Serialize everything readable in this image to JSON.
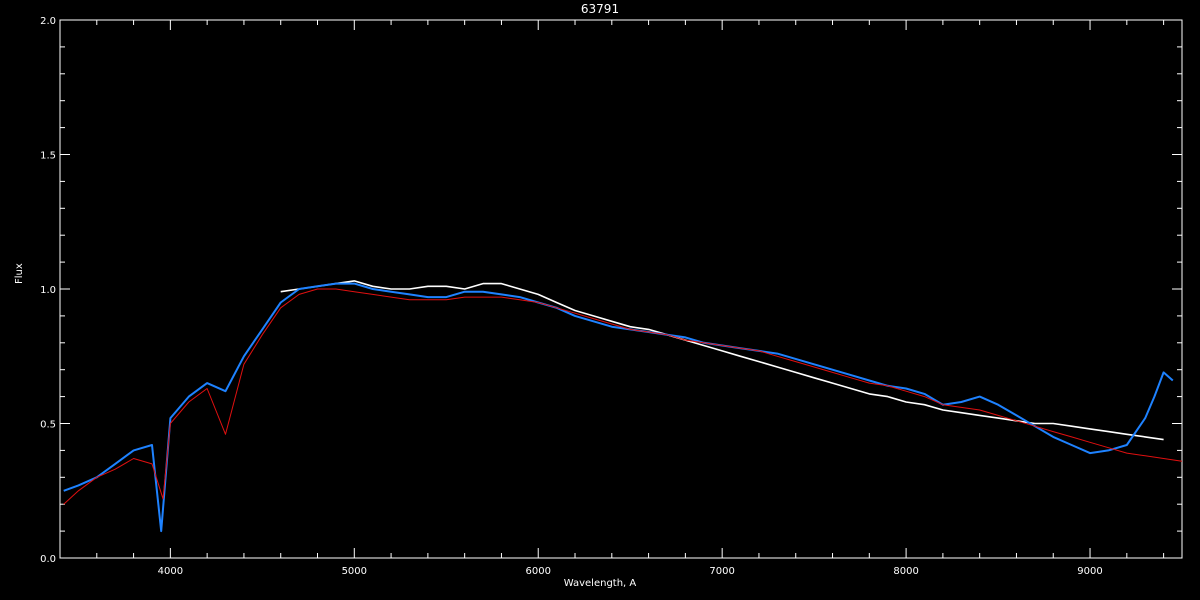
{
  "chart_data": {
    "type": "line",
    "title": "63791",
    "xlabel": "Wavelength, A",
    "ylabel": "Flux",
    "xlim": [
      3400,
      9500
    ],
    "ylim": [
      0.0,
      2.0
    ],
    "x_ticks": [
      4000,
      5000,
      6000,
      7000,
      8000,
      9000
    ],
    "y_ticks": [
      0.0,
      0.5,
      1.0,
      1.5,
      2.0
    ],
    "x_tick_labels": [
      "4000",
      "5000",
      "6000",
      "7000",
      "8000",
      "9000"
    ],
    "y_tick_labels": [
      "0.0",
      "0.5",
      "1.0",
      "1.5",
      "2.0"
    ],
    "grid": false,
    "background": "#000000",
    "axis_color": "#ffffff",
    "series": [
      {
        "color": "#ffffff",
        "x": [
          4600,
          4700,
          4800,
          4900,
          5000,
          5100,
          5200,
          5300,
          5400,
          5500,
          5600,
          5700,
          5800,
          5900,
          6000,
          6100,
          6200,
          6300,
          6400,
          6500,
          6600,
          6700,
          6800,
          6900,
          7000,
          7100,
          7200,
          7300,
          7400,
          7500,
          7600,
          7700,
          7800,
          7900,
          8000,
          8100,
          8200,
          8300,
          8400,
          8500,
          8600,
          8700,
          8800,
          8900,
          9000,
          9100,
          9200,
          9300,
          9400
        ],
        "y": [
          0.99,
          1.0,
          1.01,
          1.02,
          1.03,
          1.01,
          1.0,
          1.0,
          1.01,
          1.01,
          1.0,
          1.02,
          1.02,
          1.0,
          0.98,
          0.95,
          0.92,
          0.9,
          0.88,
          0.86,
          0.85,
          0.83,
          0.81,
          0.79,
          0.77,
          0.75,
          0.73,
          0.71,
          0.69,
          0.67,
          0.65,
          0.63,
          0.61,
          0.6,
          0.58,
          0.57,
          0.55,
          0.54,
          0.53,
          0.52,
          0.51,
          0.5,
          0.5,
          0.49,
          0.48,
          0.47,
          0.46,
          0.45,
          0.44
        ]
      },
      {
        "color": "#1e82ff",
        "x": [
          3420,
          3500,
          3600,
          3700,
          3800,
          3900,
          3950,
          4000,
          4100,
          4200,
          4300,
          4400,
          4500,
          4600,
          4700,
          4800,
          4900,
          5000,
          5100,
          5200,
          5300,
          5400,
          5500,
          5600,
          5700,
          5800,
          5900,
          6000,
          6100,
          6200,
          6300,
          6400,
          6500,
          6600,
          6700,
          6800,
          6900,
          7000,
          7100,
          7200,
          7300,
          7400,
          7500,
          7600,
          7700,
          7800,
          7900,
          8000,
          8100,
          8200,
          8300,
          8400,
          8500,
          8600,
          8700,
          8800,
          8900,
          9000,
          9100,
          9200,
          9300,
          9350,
          9400,
          9450
        ],
        "y": [
          0.25,
          0.27,
          0.3,
          0.35,
          0.4,
          0.42,
          0.1,
          0.52,
          0.6,
          0.65,
          0.62,
          0.75,
          0.85,
          0.95,
          1.0,
          1.01,
          1.02,
          1.02,
          1.0,
          0.99,
          0.98,
          0.97,
          0.97,
          0.99,
          0.99,
          0.98,
          0.97,
          0.95,
          0.93,
          0.9,
          0.88,
          0.86,
          0.85,
          0.84,
          0.83,
          0.82,
          0.8,
          0.79,
          0.78,
          0.77,
          0.76,
          0.74,
          0.72,
          0.7,
          0.68,
          0.66,
          0.64,
          0.63,
          0.61,
          0.57,
          0.58,
          0.6,
          0.57,
          0.53,
          0.49,
          0.45,
          0.42,
          0.39,
          0.4,
          0.42,
          0.52,
          0.6,
          0.69,
          0.66
        ]
      },
      {
        "color": "#e01010",
        "x": [
          3420,
          3500,
          3600,
          3700,
          3800,
          3900,
          3960,
          4000,
          4100,
          4200,
          4300,
          4400,
          4500,
          4600,
          4700,
          4800,
          4900,
          5000,
          5100,
          5200,
          5300,
          5400,
          5500,
          5600,
          5700,
          5800,
          5900,
          6000,
          6100,
          6200,
          6300,
          6400,
          6500,
          6600,
          6700,
          6800,
          6900,
          7000,
          7100,
          7200,
          7300,
          7400,
          7500,
          7600,
          7700,
          7800,
          7900,
          8000,
          8100,
          8200,
          8300,
          8400,
          8500,
          8600,
          8700,
          8800,
          8900,
          9000,
          9100,
          9200,
          9300,
          9400,
          9500
        ],
        "y": [
          0.2,
          0.25,
          0.3,
          0.33,
          0.37,
          0.35,
          0.22,
          0.5,
          0.58,
          0.63,
          0.46,
          0.72,
          0.83,
          0.93,
          0.98,
          1.0,
          1.0,
          0.99,
          0.98,
          0.97,
          0.96,
          0.96,
          0.96,
          0.97,
          0.97,
          0.97,
          0.96,
          0.95,
          0.93,
          0.91,
          0.89,
          0.87,
          0.85,
          0.84,
          0.83,
          0.81,
          0.8,
          0.79,
          0.78,
          0.77,
          0.75,
          0.73,
          0.71,
          0.69,
          0.67,
          0.65,
          0.64,
          0.62,
          0.6,
          0.57,
          0.56,
          0.55,
          0.53,
          0.51,
          0.49,
          0.47,
          0.45,
          0.43,
          0.41,
          0.39,
          0.38,
          0.37,
          0.36
        ]
      }
    ]
  }
}
